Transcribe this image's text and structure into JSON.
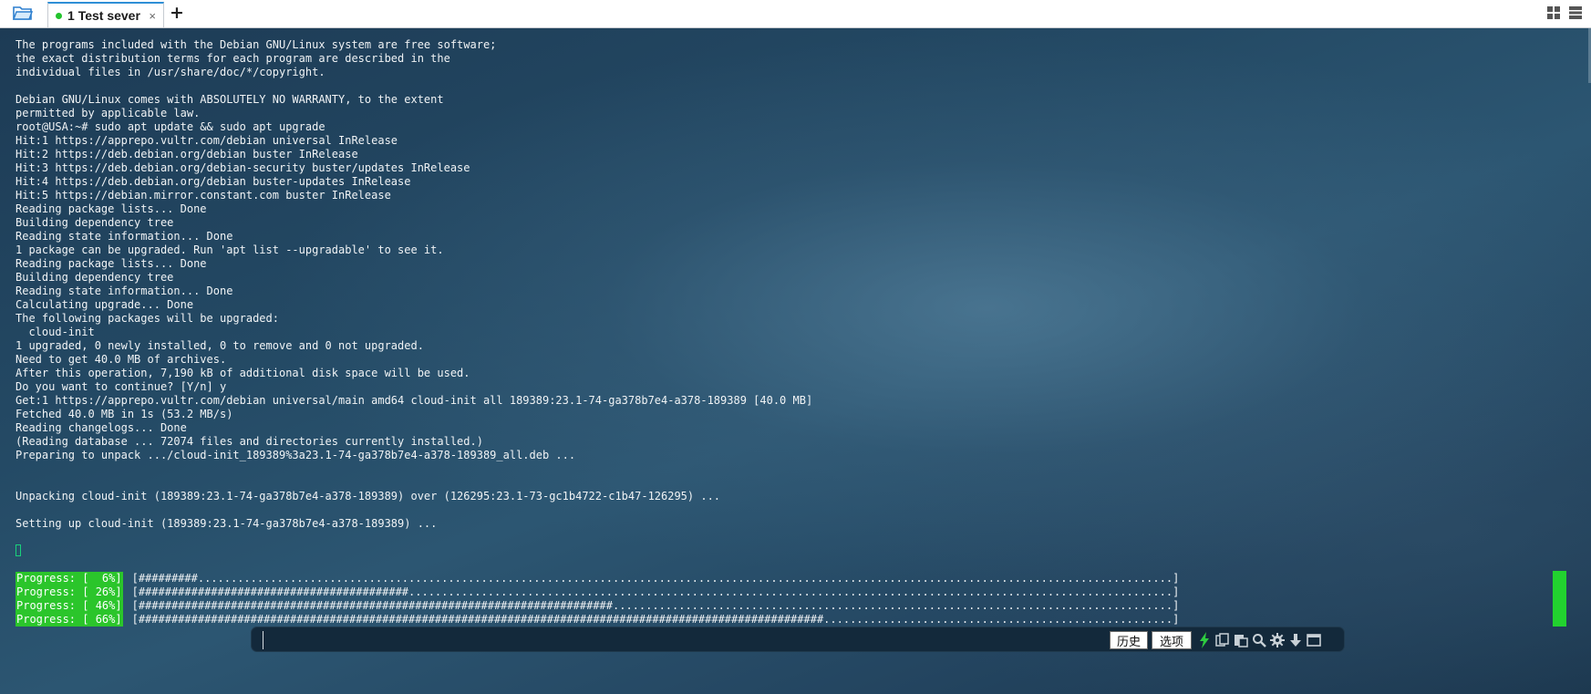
{
  "tab": {
    "number": "1",
    "title": "Test sever",
    "close": "×"
  },
  "add_tab": "+",
  "terminal_lines": [
    "The programs included with the Debian GNU/Linux system are free software;",
    "the exact distribution terms for each program are described in the",
    "individual files in /usr/share/doc/*/copyright.",
    "",
    "Debian GNU/Linux comes with ABSOLUTELY NO WARRANTY, to the extent",
    "permitted by applicable law.",
    "root@USA:~# sudo apt update && sudo apt upgrade",
    "Hit:1 https://apprepo.vultr.com/debian universal InRelease",
    "Hit:2 https://deb.debian.org/debian buster InRelease",
    "Hit:3 https://deb.debian.org/debian-security buster/updates InRelease",
    "Hit:4 https://deb.debian.org/debian buster-updates InRelease",
    "Hit:5 https://debian.mirror.constant.com buster InRelease",
    "Reading package lists... Done",
    "Building dependency tree",
    "Reading state information... Done",
    "1 package can be upgraded. Run 'apt list --upgradable' to see it.",
    "Reading package lists... Done",
    "Building dependency tree",
    "Reading state information... Done",
    "Calculating upgrade... Done",
    "The following packages will be upgraded:",
    "  cloud-init",
    "1 upgraded, 0 newly installed, 0 to remove and 0 not upgraded.",
    "Need to get 40.0 MB of archives.",
    "After this operation, 7,190 kB of additional disk space will be used.",
    "Do you want to continue? [Y/n] y",
    "Get:1 https://apprepo.vultr.com/debian universal/main amd64 cloud-init all 189389:23.1-74-ga378b7e4-a378-189389 [40.0 MB]",
    "Fetched 40.0 MB in 1s (53.2 MB/s)",
    "Reading changelogs... Done",
    "(Reading database ... 72074 files and directories currently installed.)",
    "Preparing to unpack .../cloud-init_189389%3a23.1-74-ga378b7e4-a378-189389_all.deb ...",
    "",
    "",
    "Unpacking cloud-init (189389:23.1-74-ga378b7e4-a378-189389) over (126295:23.1-73-gc1b4722-c1b47-126295) ...",
    "",
    "Setting up cloud-init (189389:23.1-74-ga378b7e4-a378-189389) ..."
  ],
  "progress_rows": [
    {
      "label": "Progress: [  6%]",
      "percent": 6
    },
    {
      "label": "Progress: [ 26%]",
      "percent": 26
    },
    {
      "label": "Progress: [ 46%]",
      "percent": 46
    },
    {
      "label": "Progress: [ 66%]",
      "percent": 66
    }
  ],
  "command_bar": {
    "input_value": "",
    "history_label": "历史",
    "options_label": "选项",
    "icons": [
      "lightning-icon",
      "copy-icon",
      "paste-icon",
      "search-icon",
      "gear-icon",
      "download-arrow-icon",
      "window-icon"
    ]
  },
  "colors": {
    "progress_green": "#2bc52b",
    "tab_active_dot": "#22c32c",
    "lightning": "#2ecc40",
    "terminal_text": "#f0f3f5"
  }
}
